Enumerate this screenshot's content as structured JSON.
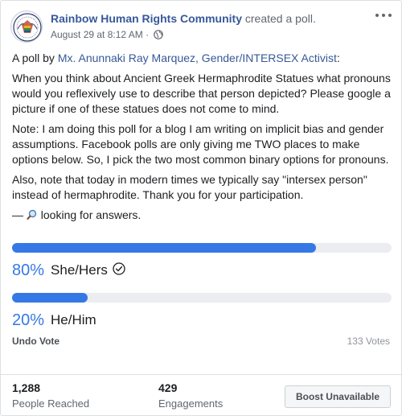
{
  "post": {
    "page_name": "Rainbow Human Rights Community",
    "action": " created a poll.",
    "timestamp": "August 29 at 8:12 AM",
    "separator": " · ",
    "privacy_icon": "globe-icon"
  },
  "content": {
    "intro_prefix": "A poll by ",
    "author_link": "Mx. Anunnaki Ray Marquez, Gender/INTERSEX Activist",
    "intro_suffix": ":",
    "question": "When you think about Ancient Greek Hermaphrodite Statues what pronouns would you reflexively use to describe that person depicted? Please google a picture if one of these statues does not come to mind.",
    "note": "Note: I am doing this poll for a blog I am writing on implicit bias and gender assumptions. Facebook polls are only giving me TWO places to make options below. So, I pick the two most common binary options for pronouns.",
    "also": "Also, note that today in modern times we typically say \"intersex person\" instead of hermaphrodite. Thank you for your participation.",
    "sign_prefix": "— ",
    "sign_icon": "magnifying-glass-icon",
    "sign_text": " looking for answers."
  },
  "poll": {
    "accent_color": "#3578e5",
    "options": [
      {
        "percent_label": "80%",
        "label": "She/Hers",
        "fraction": 0.8,
        "selected": true
      },
      {
        "percent_label": "20%",
        "label": "He/Him",
        "fraction": 0.2,
        "selected": false
      }
    ],
    "undo_label": "Undo Vote",
    "votes_label": "133 Votes"
  },
  "insights": {
    "reached_value": "1,288",
    "reached_label": "People Reached",
    "engagements_value": "429",
    "engagements_label": "Engagements",
    "boost_label": "Boost Unavailable"
  }
}
